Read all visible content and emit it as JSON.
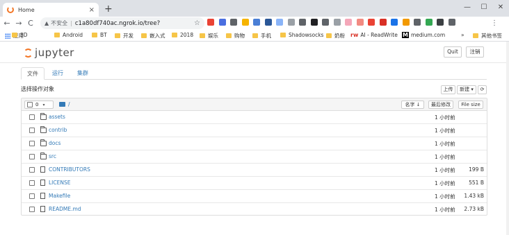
{
  "browser": {
    "tab_title": "Home",
    "close_glyph": "×",
    "new_tab_glyph": "+",
    "window_buttons": [
      "—",
      "☐",
      "✕"
    ],
    "nav": {
      "back": "←",
      "forward": "→",
      "reload": "C"
    },
    "address": {
      "warning_glyph": "▲",
      "security_label": "不安全",
      "separator": "|",
      "url": "c1a80df740ac.ngrok.io/tree?",
      "star_glyph": "☆"
    },
    "extension_colors": [
      "#ea4335",
      "#4a6ee0",
      "#5f6368",
      "#f6b400",
      "#4a7fd6",
      "#2b5797",
      "#8ab4f8",
      "#9aa0a6",
      "#5f6368",
      "#202124",
      "#5f6368",
      "#9aa0a6",
      "#f4a7b9",
      "#f28b82",
      "#ea4335",
      "#d93025",
      "#1a73e8",
      "#f29900",
      "#5f6368",
      "#34a853",
      "#3c4043",
      "#5f6368"
    ],
    "profile_glyph": "⋮",
    "bookmarks": {
      "apps_label": "应用",
      "items": [
        "3D",
        "Android",
        "BT",
        "开发",
        "嵌入式",
        "2018",
        "娱乐",
        "购物",
        "手机",
        "Shadowsocks",
        "奶粉"
      ],
      "ai_label": "AI - ReadWrite",
      "ai_glyph": "rw",
      "medium_label": "medium.com",
      "medium_glyph": "M",
      "more_glyph": "»",
      "other_label": "其他书签"
    }
  },
  "jupyter": {
    "logo_text": "jupyter",
    "quit_label": "Quit",
    "logout_label": "注销",
    "tabs": [
      "文件",
      "运行",
      "集群"
    ],
    "select_label": "选择操作对象",
    "upload_label": "上传",
    "new_label": "新建 ▾",
    "refresh_glyph": "⟳",
    "selected_count": "0",
    "caret": "▾",
    "breadcrumb": "/",
    "columns": {
      "name": "名字 ↓",
      "modified": "最后修改",
      "size": "File size"
    },
    "files": [
      {
        "name": "assets",
        "type": "folder",
        "modified": "1 小时前",
        "size": ""
      },
      {
        "name": "contrib",
        "type": "folder",
        "modified": "1 小时前",
        "size": ""
      },
      {
        "name": "docs",
        "type": "folder",
        "modified": "1 小时前",
        "size": ""
      },
      {
        "name": "src",
        "type": "folder",
        "modified": "1 小时前",
        "size": ""
      },
      {
        "name": "CONTRIBUTORS",
        "type": "file",
        "modified": "1 小时前",
        "size": "199 B"
      },
      {
        "name": "LICENSE",
        "type": "file",
        "modified": "1 小时前",
        "size": "551 B"
      },
      {
        "name": "Makefile",
        "type": "file",
        "modified": "1 小时前",
        "size": "1.43 kB"
      },
      {
        "name": "README.md",
        "type": "file",
        "modified": "1 小时前",
        "size": "2.73 kB"
      }
    ]
  }
}
